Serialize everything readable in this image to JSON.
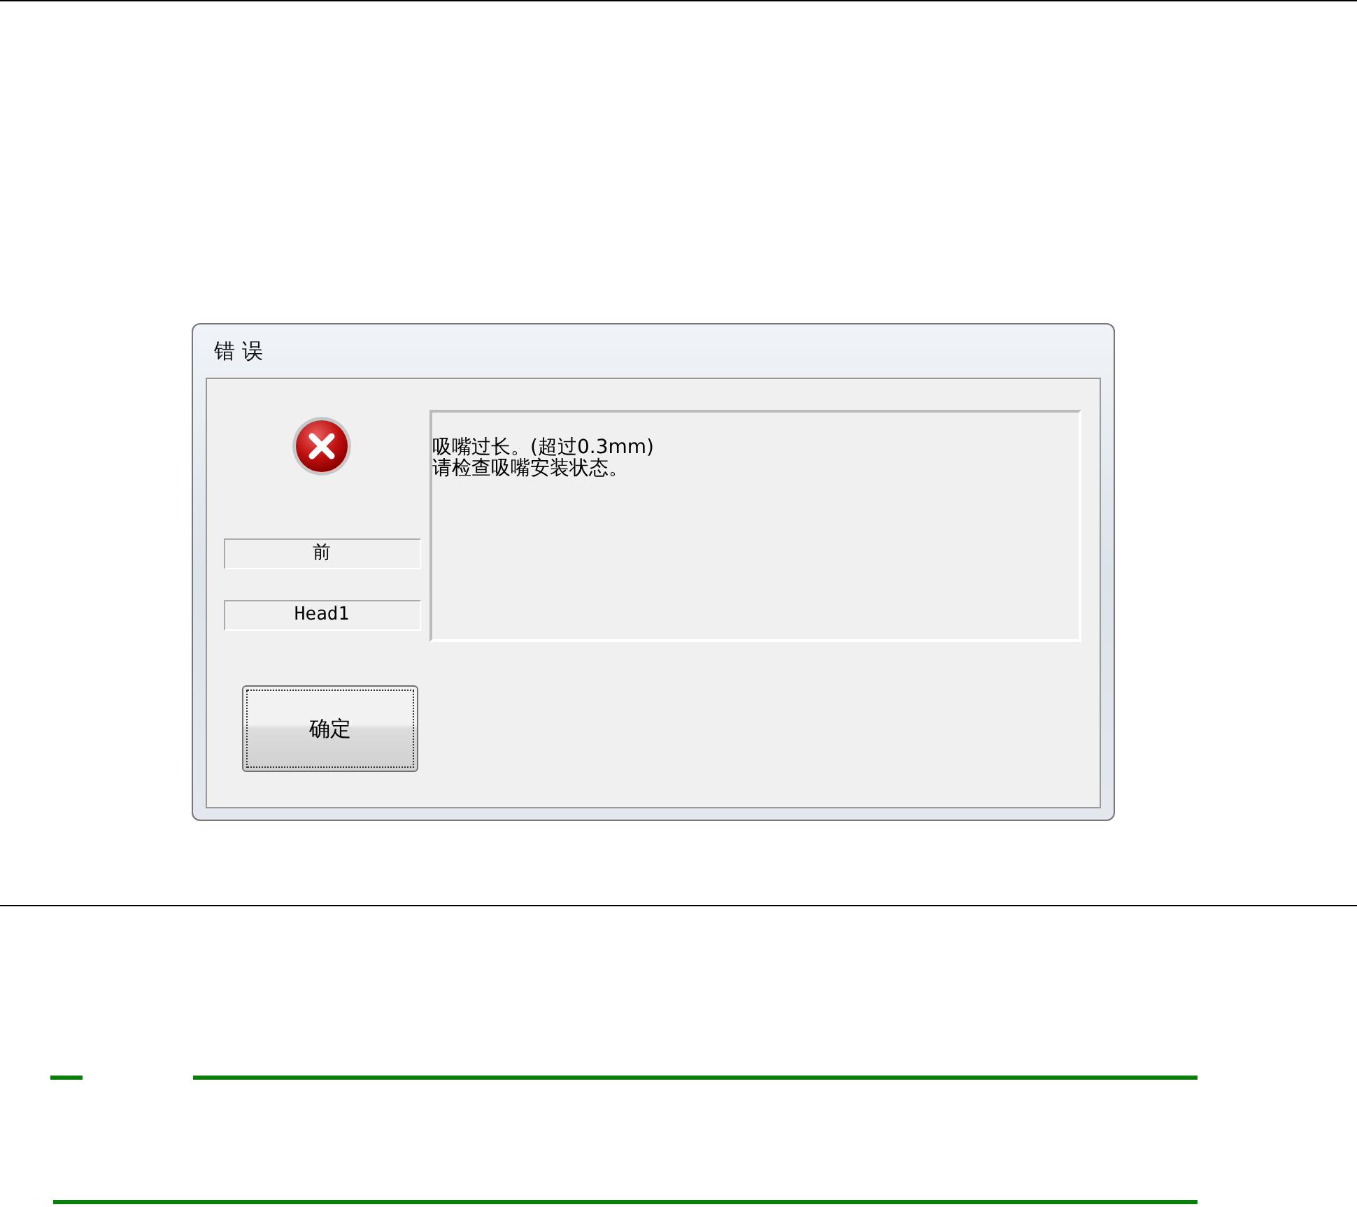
{
  "dialog": {
    "title": "错 误",
    "labels": [
      "前",
      "Head1"
    ],
    "message": [
      "吸嘴过长。(超过0.3mm)",
      "请检查吸嘴安装状态。"
    ],
    "button": "确定"
  }
}
